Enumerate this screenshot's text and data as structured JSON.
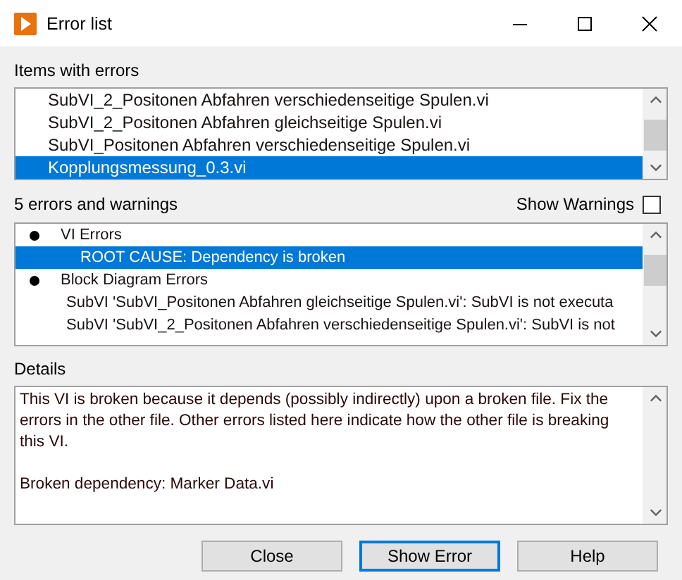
{
  "window": {
    "title": "Error list"
  },
  "items_label": "Items with errors",
  "items": [
    {
      "label": "SubVI_2_Positonen Abfahren verschiedenseitige Spulen.vi",
      "selected": false
    },
    {
      "label": "SubVI_2_Positonen Abfahren gleichseitige Spulen.vi",
      "selected": false
    },
    {
      "label": "SubVI_Positonen Abfahren verschiedenseitige Spulen.vi",
      "selected": false
    },
    {
      "label": "Kopplungsmessung_0.3.vi",
      "selected": true
    }
  ],
  "errors_label": "5 errors and warnings",
  "show_warnings": {
    "label": "Show Warnings",
    "checked": false
  },
  "errors": [
    {
      "label": "VI Errors",
      "selected": false,
      "children": [
        {
          "label": "ROOT CAUSE: Dependency is broken",
          "selected": true
        }
      ]
    },
    {
      "label": "Block Diagram Errors",
      "selected": false,
      "children": [
        {
          "label": "SubVI 'SubVI_Positonen Abfahren gleichseitige Spulen.vi': SubVI is not executa",
          "selected": false
        },
        {
          "label": "SubVI 'SubVI_2_Positonen Abfahren verschiedenseitige Spulen.vi': SubVI is not",
          "selected": false
        }
      ]
    }
  ],
  "details_label": "Details",
  "details": [
    "This VI is broken because it depends (possibly indirectly) upon a broken file. Fix the errors in the other file. Other errors listed here indicate how the other file is breaking this VI.",
    "Broken dependency: Marker Data.vi"
  ],
  "buttons": [
    {
      "label": "Close",
      "default": false
    },
    {
      "label": "Show Error",
      "default": true
    },
    {
      "label": "Help",
      "default": false
    }
  ]
}
